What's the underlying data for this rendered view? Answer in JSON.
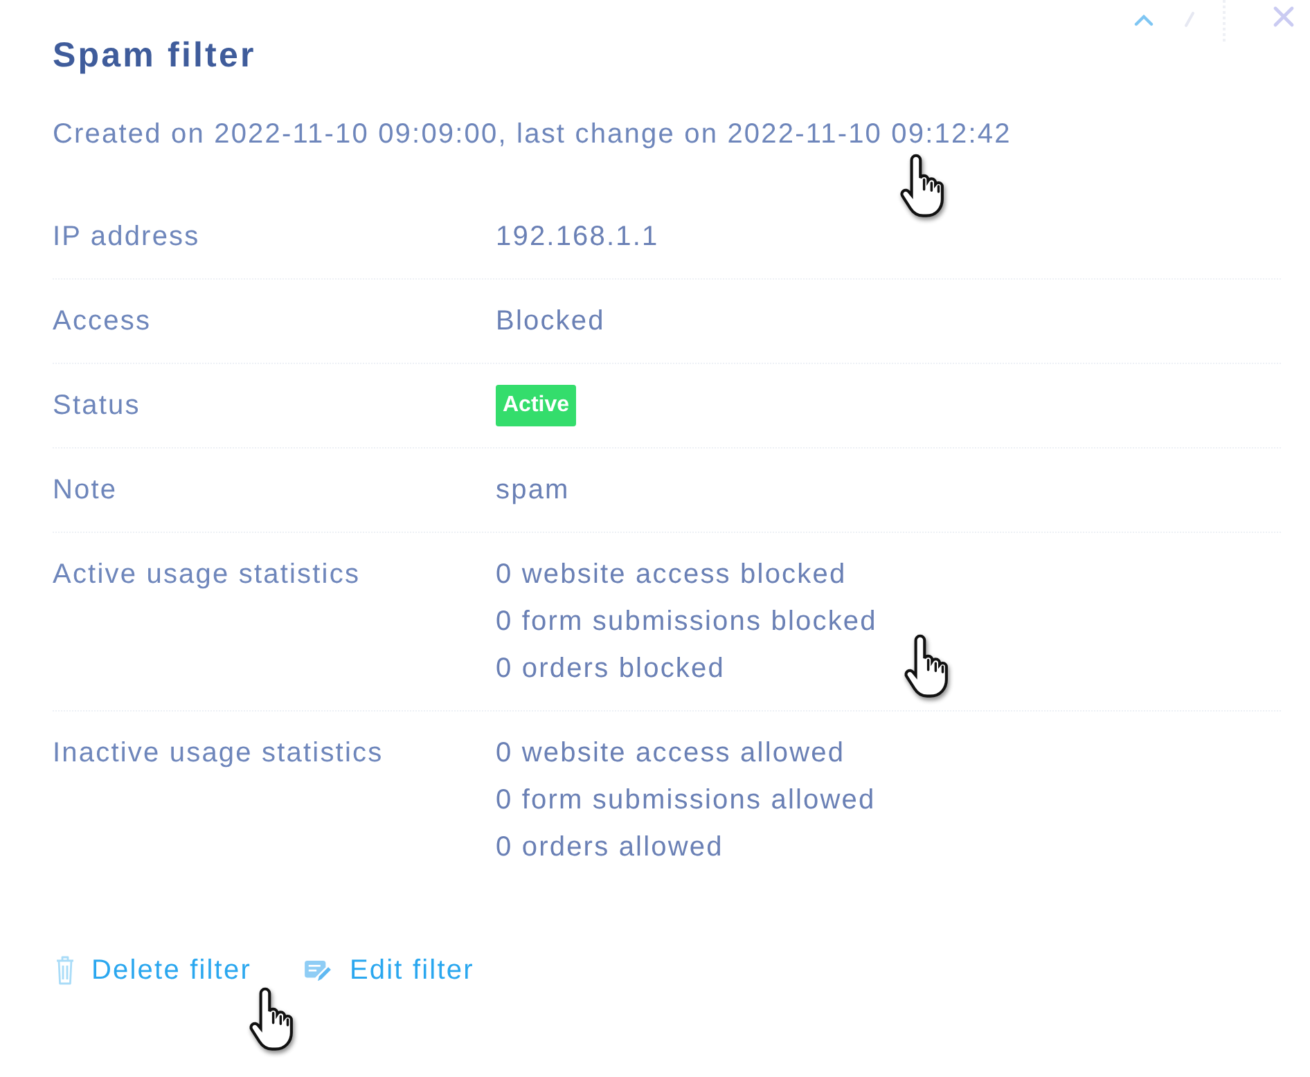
{
  "panel": {
    "title": "Spam filter",
    "meta": "Created on 2022-11-10 09:09:00, last change on 2022-11-10 09:12:42"
  },
  "details": [
    {
      "kind": "text",
      "label": "IP address",
      "value": "192.168.1.1"
    },
    {
      "kind": "text",
      "label": "Access",
      "value": "Blocked"
    },
    {
      "kind": "badge",
      "label": "Status",
      "value": "Active"
    },
    {
      "kind": "text",
      "label": "Note",
      "value": "spam"
    },
    {
      "kind": "lines",
      "label": "Active usage statistics",
      "lines": [
        "0 website access blocked",
        "0 form submissions blocked",
        "0 orders blocked"
      ]
    },
    {
      "kind": "lines",
      "label": "Inactive usage statistics",
      "lines": [
        "0 website access allowed",
        "0 form submissions allowed",
        "0 orders allowed"
      ]
    }
  ],
  "actions": [
    {
      "kind": "delete",
      "label": "Delete filter"
    },
    {
      "kind": "edit",
      "label": "Edit filter"
    }
  ]
}
